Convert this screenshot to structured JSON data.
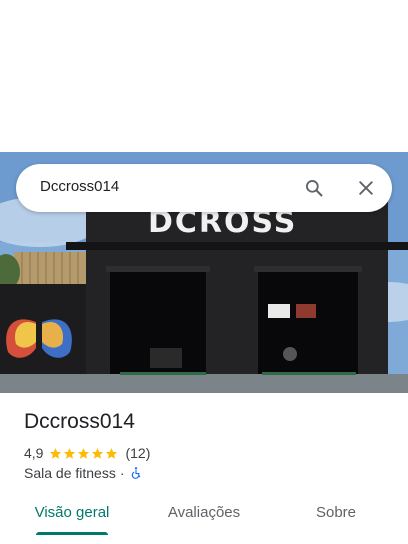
{
  "search": {
    "query": "Dccross014"
  },
  "place": {
    "photo_sign": "DCROSS",
    "name": "Dccross014",
    "rating": "4,9",
    "rating_value": 4.9,
    "stars": 5,
    "reviews": "(12)",
    "category": "Sala de fitness",
    "separator": "·"
  },
  "tabs": [
    {
      "label": "Visão geral",
      "active": true
    },
    {
      "label": "Avaliações",
      "active": false
    },
    {
      "label": "Sobre",
      "active": false
    }
  ],
  "colors": {
    "accent": "#00796b",
    "star": "#fbbc04",
    "accessible": "#1a73e8"
  }
}
